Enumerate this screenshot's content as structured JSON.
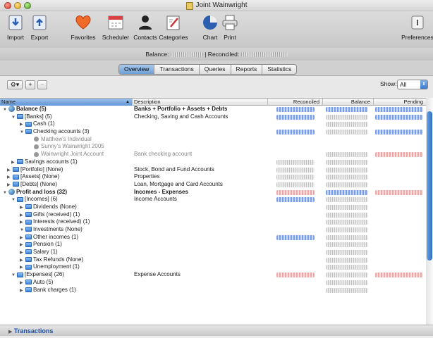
{
  "window": {
    "title": "Joint Wainwright"
  },
  "toolbar": {
    "items": [
      {
        "label": "Import",
        "icon": "import-icon"
      },
      {
        "label": "Export",
        "icon": "export-icon"
      },
      {
        "label": "Favorites",
        "icon": "heart-icon"
      },
      {
        "label": "Scheduler",
        "icon": "scheduler-icon"
      },
      {
        "label": "Contacts",
        "icon": "contacts-icon"
      },
      {
        "label": "Categories",
        "icon": "categories-icon"
      },
      {
        "label": "Chart",
        "icon": "chart-icon"
      },
      {
        "label": "Print",
        "icon": "print-icon"
      },
      {
        "label": "Preferences",
        "icon": "preferences-icon"
      }
    ]
  },
  "balance": {
    "balance_label": "Balance:",
    "reconciled_label": "| Reconciled:"
  },
  "tabs": [
    "Overview",
    "Transactions",
    "Queries",
    "Reports",
    "Statistics"
  ],
  "active_tab": "Overview",
  "filter": {
    "show_label": "Show:",
    "value": "All"
  },
  "table": {
    "columns": [
      "Name",
      "Description",
      "Reconciled",
      "Balance",
      "Pending"
    ],
    "rows": [
      {
        "name": "Balance (5)",
        "desc": "Banks + Portfolio + Assets + Debts"
      },
      {
        "name": "[Banks] (5)",
        "desc": "Checking, Saving and Cash Accounts"
      },
      {
        "name": "Cash (1)",
        "desc": ""
      },
      {
        "name": "Checking accounts (3)",
        "desc": ""
      },
      {
        "name": "Matthew's Individual",
        "desc": ""
      },
      {
        "name": "Sunny's Wainwright 2005",
        "desc": ""
      },
      {
        "name": "Wainwright Joint Account",
        "desc": "Bank checking account"
      },
      {
        "name": "Savings accounts (1)",
        "desc": ""
      },
      {
        "name": "[Portfolio] (None)",
        "desc": "Stock, Bond and Fund Accounts"
      },
      {
        "name": "[Assets] (None)",
        "desc": "Properties"
      },
      {
        "name": "[Debts] (None)",
        "desc": "Loan, Mortgage and Card Accounts"
      },
      {
        "name": "Profit and loss (32)",
        "desc": "Incomes - Expenses"
      },
      {
        "name": "[Incomes] (6)",
        "desc": "Income Accounts"
      },
      {
        "name": "Dividends (None)",
        "desc": ""
      },
      {
        "name": "Gifts (received) (1)",
        "desc": ""
      },
      {
        "name": "Interests (received) (1)",
        "desc": ""
      },
      {
        "name": "Investments (None)",
        "desc": ""
      },
      {
        "name": "Other incomes (1)",
        "desc": ""
      },
      {
        "name": "Pension (1)",
        "desc": ""
      },
      {
        "name": "Salary (1)",
        "desc": ""
      },
      {
        "name": "Tax Refunds (None)",
        "desc": ""
      },
      {
        "name": "Unemployment (1)",
        "desc": ""
      },
      {
        "name": "[Expenses] (26)",
        "desc": "Expense Accounts"
      },
      {
        "name": "Auto (5)",
        "desc": ""
      },
      {
        "name": "Bank charges (1)",
        "desc": ""
      }
    ]
  },
  "footer": {
    "label": "Transactions"
  },
  "colors": {
    "accent": "#3a7bd0",
    "positive": "#4a7de0",
    "negative": "#e06a6a"
  }
}
